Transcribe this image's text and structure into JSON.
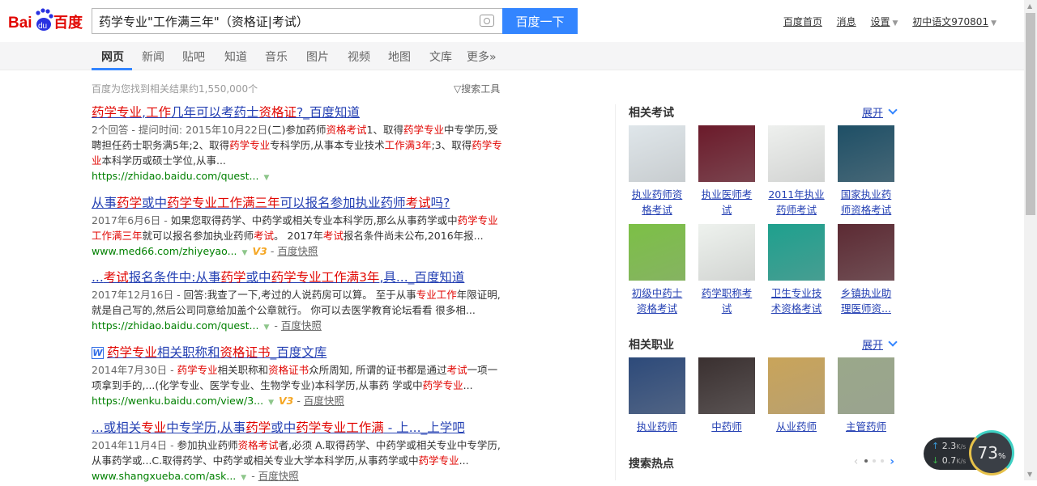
{
  "header": {
    "logo_text": "Bai du 百度",
    "search_value": "药学专业\"工作满三年\"（资格证|考试）",
    "search_button": "百度一下",
    "top_links": [
      "百度首页",
      "消息",
      "设置",
      "初中语文970801"
    ]
  },
  "nav": {
    "tabs": [
      "网页",
      "新闻",
      "贴吧",
      "知道",
      "音乐",
      "图片",
      "视频",
      "地图",
      "文库",
      "更多»"
    ],
    "active": "网页"
  },
  "result_count": "百度为您找到相关结果约1,550,000个",
  "search_tools": "搜索工具",
  "results": [
    {
      "title": [
        [
          "药学专业",
          1
        ],
        [
          ",",
          0
        ],
        [
          "工作",
          1
        ],
        [
          "几年可以考药士",
          0
        ],
        [
          "资格证",
          1
        ],
        [
          "?_百度知道",
          0
        ]
      ],
      "date": "2个回答 - 提问时间: 2015年10月22日",
      "abstract": [
        [
          "(二)参加药师",
          0
        ],
        [
          "资格考试",
          1
        ],
        [
          "1、取得",
          0
        ],
        [
          "药学专业",
          1
        ],
        [
          "中专学历,受聘担任药士职务满5年;2、取得",
          0
        ],
        [
          "药学专业",
          1
        ],
        [
          "专科学历,从事本专业技术",
          0
        ],
        [
          "工作满3年",
          1
        ],
        [
          ";3、取得",
          0
        ],
        [
          "药学专业",
          1
        ],
        [
          "本科学历或硕士学位,从事...",
          0
        ]
      ],
      "url": "https://zhidao.baidu.com/quest...",
      "v3": false,
      "cache": ""
    },
    {
      "title": [
        [
          "从事",
          0
        ],
        [
          "药学",
          1
        ],
        [
          "或中",
          0
        ],
        [
          "药学专业工作满三年",
          1
        ],
        [
          "可以报名参加执业药师",
          0
        ],
        [
          "考试",
          1
        ],
        [
          "吗?",
          0
        ]
      ],
      "date": "2017年6月6日 - ",
      "abstract": [
        [
          "如果您取得药学、中药学或相关专业本科学历,那么从事药学或中",
          0
        ],
        [
          "药学专业工作满三年",
          1
        ],
        [
          "就可以报名参加执业药师",
          0
        ],
        [
          "考试",
          1
        ],
        [
          "。 2017年",
          0
        ],
        [
          "考试",
          1
        ],
        [
          "报名条件尚未公布,2016年报...",
          0
        ]
      ],
      "url": "www.med66.com/zhiyeyao...",
      "v3": true,
      "cache": "百度快照"
    },
    {
      "title": [
        [
          "...",
          0
        ],
        [
          "考试",
          1
        ],
        [
          "报名条件中:从事",
          0
        ],
        [
          "药学",
          1
        ],
        [
          "或中",
          0
        ],
        [
          "药学专业工作满3年",
          1
        ],
        [
          ",具..._百度知道",
          0
        ]
      ],
      "date": "2017年12月16日 - ",
      "abstract": [
        [
          "回答:我查了一下,考过的人说药房可以算。 至于从事",
          0
        ],
        [
          "专业工作",
          1
        ],
        [
          "年限证明,就是自己写的,然后公司同意给加盖个公章就行。 你可以去医学教育论坛看看 很多相...",
          0
        ]
      ],
      "url": "https://zhidao.baidu.com/quest...",
      "v3": false,
      "cache": "百度快照"
    },
    {
      "icon": "W",
      "title": [
        [
          "药学专业",
          1
        ],
        [
          "相关职称和",
          0
        ],
        [
          "资格证书",
          1
        ],
        [
          "_百度文库",
          0
        ]
      ],
      "date": "2014年7月30日 - ",
      "abstract": [
        [
          "药学专业",
          1
        ],
        [
          "相关职称和",
          0
        ],
        [
          "资格证书",
          1
        ],
        [
          "众所周知, 所谓的证书都是通过",
          0
        ],
        [
          "考试",
          1
        ],
        [
          "一项一项拿到手的,...(化学专业、医学专业、生物学专业)本科学历,从事药 学或中",
          0
        ],
        [
          "药学专业",
          1
        ],
        [
          "...",
          0
        ]
      ],
      "url": "https://wenku.baidu.com/view/3...",
      "v3": true,
      "cache": "百度快照"
    },
    {
      "title": [
        [
          "...或相关",
          0
        ],
        [
          "专业",
          1
        ],
        [
          "中专学历,从事",
          0
        ],
        [
          "药学",
          1
        ],
        [
          "或中",
          0
        ],
        [
          "药学专业工作满",
          1
        ],
        [
          " - 上..._上学吧",
          0
        ]
      ],
      "date": "2014年11月4日 - ",
      "abstract": [
        [
          "参加执业药师",
          0
        ],
        [
          "资格考试",
          1
        ],
        [
          "者,必须 A.取得药学、中药学或相关专业中专学历,从事药学或...C.取得药学、中药学或相关专业大学本科学历,从事药学或中",
          0
        ],
        [
          "药学专业",
          1
        ],
        [
          "...",
          0
        ]
      ],
      "url": "www.shangxueba.com/ask...",
      "v3": false,
      "cache": "百度快照"
    }
  ],
  "sidebar": {
    "exams": {
      "title": "相关考试",
      "expand": "展开",
      "items": [
        {
          "label": "执业药师资格考试",
          "color": "#dfe6ea"
        },
        {
          "label": "执业医师考试",
          "color": "#6b1a2a"
        },
        {
          "label": "2011年执业药师考试",
          "color": "#eef0ee"
        },
        {
          "label": "国家执业药师资格考试",
          "color": "#1e4f66"
        },
        {
          "label": "初级中药士资格考试",
          "color": "#7cc046"
        },
        {
          "label": "药学职称考试",
          "color": "#eef2ee"
        },
        {
          "label": "卫生专业技术资格考试",
          "color": "#1ea08e"
        },
        {
          "label": "乡镇执业助理医师资...",
          "color": "#5c2a33"
        }
      ]
    },
    "jobs": {
      "title": "相关职业",
      "expand": "展开",
      "items": [
        {
          "label": "执业药师",
          "color": "#2d4a7a"
        },
        {
          "label": "中药师",
          "color": "#3a3030"
        },
        {
          "label": "从业药师",
          "color": "#c9a45a"
        },
        {
          "label": "主管药师",
          "color": "#9aa88a"
        }
      ]
    },
    "hot": {
      "title": "搜索热点"
    }
  },
  "widget": {
    "upload": "2.3",
    "download": "0.7",
    "unit": "K/s",
    "percent": "73",
    "percent_sign": "%"
  }
}
